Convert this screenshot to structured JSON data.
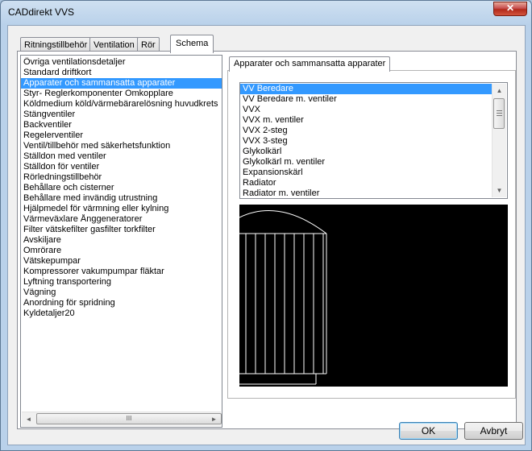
{
  "window": {
    "title": "CADdirekt VVS",
    "close_glyph": "✕"
  },
  "tabs": [
    {
      "label": "Ritningstillbehör"
    },
    {
      "label": "Ventilation"
    },
    {
      "label": "Rör"
    },
    {
      "label": "Schema",
      "active": true
    }
  ],
  "categories": {
    "selected_index": 2,
    "items": [
      "Övriga ventilationsdetaljer",
      "Standard driftkort",
      "Apparater och sammansatta apparater",
      "Styr- Reglerkomponenter Omkopplare",
      "Köldmedium  köld/värmebärarelösning huvudkrets",
      "Stängventiler",
      "Backventiler",
      "Regelerventiler",
      "Ventil/tillbehör med säkerhetsfunktion",
      "Ställdon med ventiler",
      "Ställdon för ventiler",
      "Rörledningstillbehör",
      "Behållare och cisterner",
      "Behållare med invändig utrustning",
      "Hjälpmedel för värmning eller kylning",
      "Värmeväxlare Ånggeneratorer",
      "Filter vätskefilter gasfilter torkfilter",
      "Avskiljare",
      "Omrörare",
      "Vätskepumpar",
      "Kompressorer vakumpumpar fläktar",
      "Lyftning transportering",
      "Vägning",
      "Anordning för spridning",
      "Kyldetaljer20"
    ]
  },
  "group": {
    "title": "Apparater och sammansatta apparater",
    "selected_index": 0,
    "items": [
      "VV Beredare",
      "VV Beredare m. ventiler",
      "VVX",
      "VVX m. ventiler",
      "VVX 2-steg",
      "VVX 3-steg",
      "Glykolkärl",
      "Glykolkärl m. ventiler",
      "Expansionskärl",
      "Radiator",
      "Radiator m. ventiler"
    ]
  },
  "scrollbar": {
    "left_arrow": "◄",
    "right_arrow": "►",
    "up_arrow": "▲",
    "down_arrow": "▼",
    "thumb_grip": "III"
  },
  "buttons": {
    "ok": "OK",
    "cancel": "Avbryt"
  },
  "colors": {
    "selection": "#3399ff",
    "preview_bg": "#000000",
    "preview_stroke": "#ffffff"
  },
  "icons": [
    "close-icon",
    "scroll-left-icon",
    "scroll-right-icon",
    "scroll-up-icon",
    "scroll-down-icon"
  ]
}
